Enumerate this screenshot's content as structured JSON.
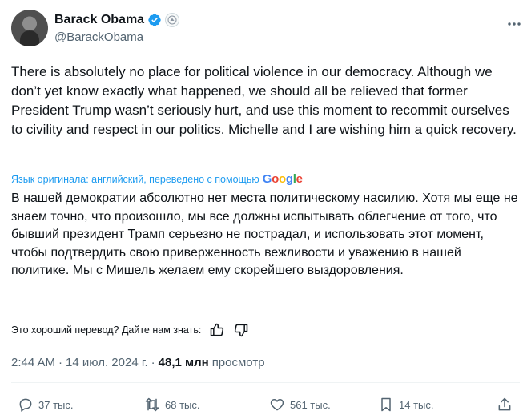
{
  "author": {
    "display_name": "Barack Obama",
    "handle": "@BarackObama"
  },
  "tweet": {
    "text": "There is absolutely no place for political violence in our democracy. Although we don’t yet know exactly what happened, we should all be relieved that former President Trump wasn’t seriously hurt, and use this moment to recommit ourselves to civility and respect in our politics. Michelle and I are wishing him a quick recovery.",
    "translation_note": "Язык оригинала: английский, переведено с помощью",
    "translation_provider": [
      "G",
      "o",
      "o",
      "g",
      "l",
      "e"
    ],
    "translated_text": "В нашей демократии абсолютно нет места политическому насилию. Хотя мы еще не знаем точно, что произошло, мы все должны испытывать облегчение от того, что бывший президент Трамп серьезно не пострадал, и использовать этот момент, чтобы подтвердить свою приверженность вежливости и уважению в нашей политике. Мы с Мишель желаем ему скорейшего выздоровления.",
    "feedback_prompt": "Это хороший перевод? Дайте нам знать:"
  },
  "meta": {
    "time": "2:44 AM",
    "separator1": "·",
    "date": "14 июл. 2024 г.",
    "separator2": "·",
    "views_count": "48,1 млн",
    "views_label": "просмотр"
  },
  "actions": {
    "replies": "37 тыс.",
    "reposts": "68 тыс.",
    "likes": "561 тыс.",
    "bookmarks": "14 тыс."
  },
  "icons": {
    "verified": "verified-badge-icon",
    "government": "government-seal-icon",
    "more": "more-dots-icon",
    "reply": "reply-icon",
    "repost": "repost-icon",
    "like": "heart-icon",
    "bookmark": "bookmark-icon",
    "share": "share-icon",
    "thumbs_up": "thumbs-up-icon",
    "thumbs_down": "thumbs-down-icon"
  },
  "colors": {
    "accent": "#1d9bf0",
    "secondary_text": "#536471",
    "primary_text": "#0f1419"
  }
}
